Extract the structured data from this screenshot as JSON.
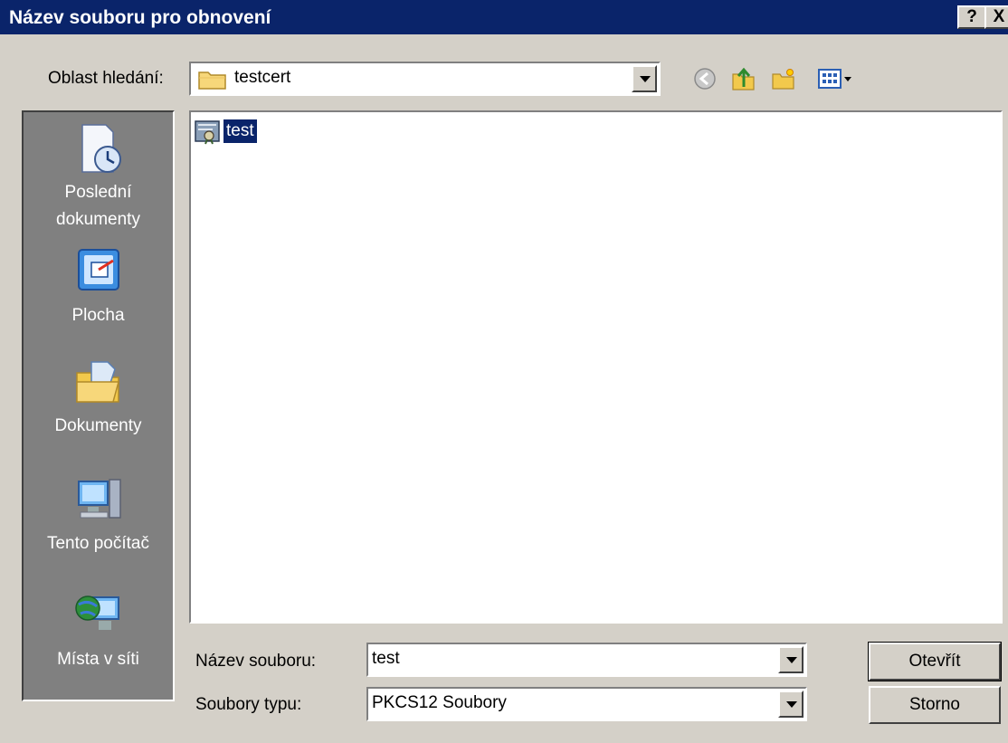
{
  "window": {
    "title": "Název souboru pro obnovení",
    "help_label": "?",
    "close_label": "X"
  },
  "toolbar": {
    "lookin_label": "Oblast hledání:",
    "lookin_value": "testcert"
  },
  "places": [
    {
      "label": "Poslední dokumenty",
      "icon": "recent-documents-icon"
    },
    {
      "label": "Plocha",
      "icon": "desktop-icon"
    },
    {
      "label": "Dokumenty",
      "icon": "my-documents-icon"
    },
    {
      "label": "Tento počítač",
      "icon": "my-computer-icon"
    },
    {
      "label": "Místa v síti",
      "icon": "network-places-icon"
    }
  ],
  "files": [
    {
      "name": "test",
      "icon": "certificate-icon",
      "selected": true
    }
  ],
  "form": {
    "filename_label": "Název souboru:",
    "filename_value": "test",
    "filetype_label": "Soubory typu:",
    "filetype_value": "PKCS12 Soubory"
  },
  "buttons": {
    "open": "Otevřít",
    "cancel": "Storno"
  },
  "colors": {
    "titlebar": "#0a246a",
    "dialog": "#d4d0c8",
    "places_bg": "#808080",
    "selection": "#0a246a"
  }
}
